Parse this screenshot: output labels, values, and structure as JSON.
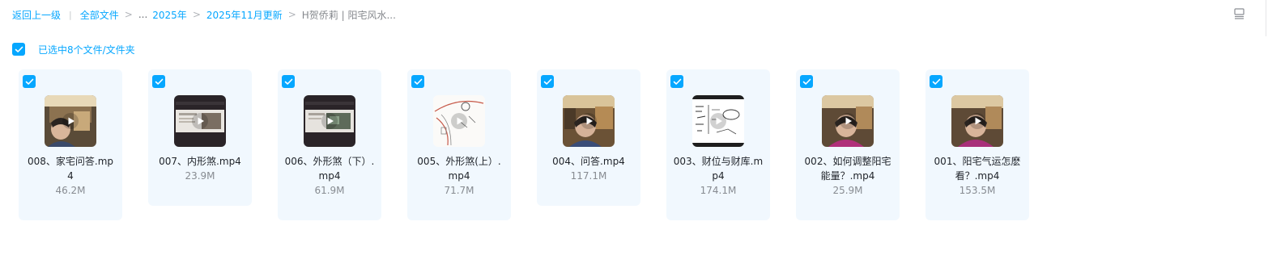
{
  "breadcrumb": {
    "back_label": "返回上一级",
    "root_label": "全部文件",
    "ellipsis": "...",
    "path_items": [
      "2025年",
      "2025年11月更新"
    ],
    "current": "H贺侨莉 | 阳宅风水..."
  },
  "selection": {
    "label": "已选中8个文件/文件夹"
  },
  "files": [
    {
      "name": "008、家宅问答.mp4",
      "size": "46.2M",
      "thumb": "room"
    },
    {
      "name": "007、内形煞.mp4",
      "size": "23.9M",
      "thumb": "slide"
    },
    {
      "name": "006、外形煞（下）.mp4",
      "size": "61.9M",
      "thumb": "slide"
    },
    {
      "name": "005、外形煞(上）.mp4",
      "size": "71.7M",
      "thumb": "sketch"
    },
    {
      "name": "004、问答.mp4",
      "size": "117.1M",
      "thumb": "room"
    },
    {
      "name": "003、财位与财库.mp4",
      "size": "174.1M",
      "thumb": "whiteboard"
    },
    {
      "name": "002、如何调整阳宅能量？.mp4",
      "size": "25.9M",
      "thumb": "room-pink"
    },
    {
      "name": "001、阳宅气运怎麽看？.mp4",
      "size": "153.5M",
      "thumb": "room-pink"
    }
  ],
  "colors": {
    "accent": "#06a7ff",
    "card_bg": "#f1f8fe"
  },
  "icons": {
    "checkbox": "checkmark-icon",
    "play": "play-icon",
    "view_toggle": "list-view-icon"
  }
}
